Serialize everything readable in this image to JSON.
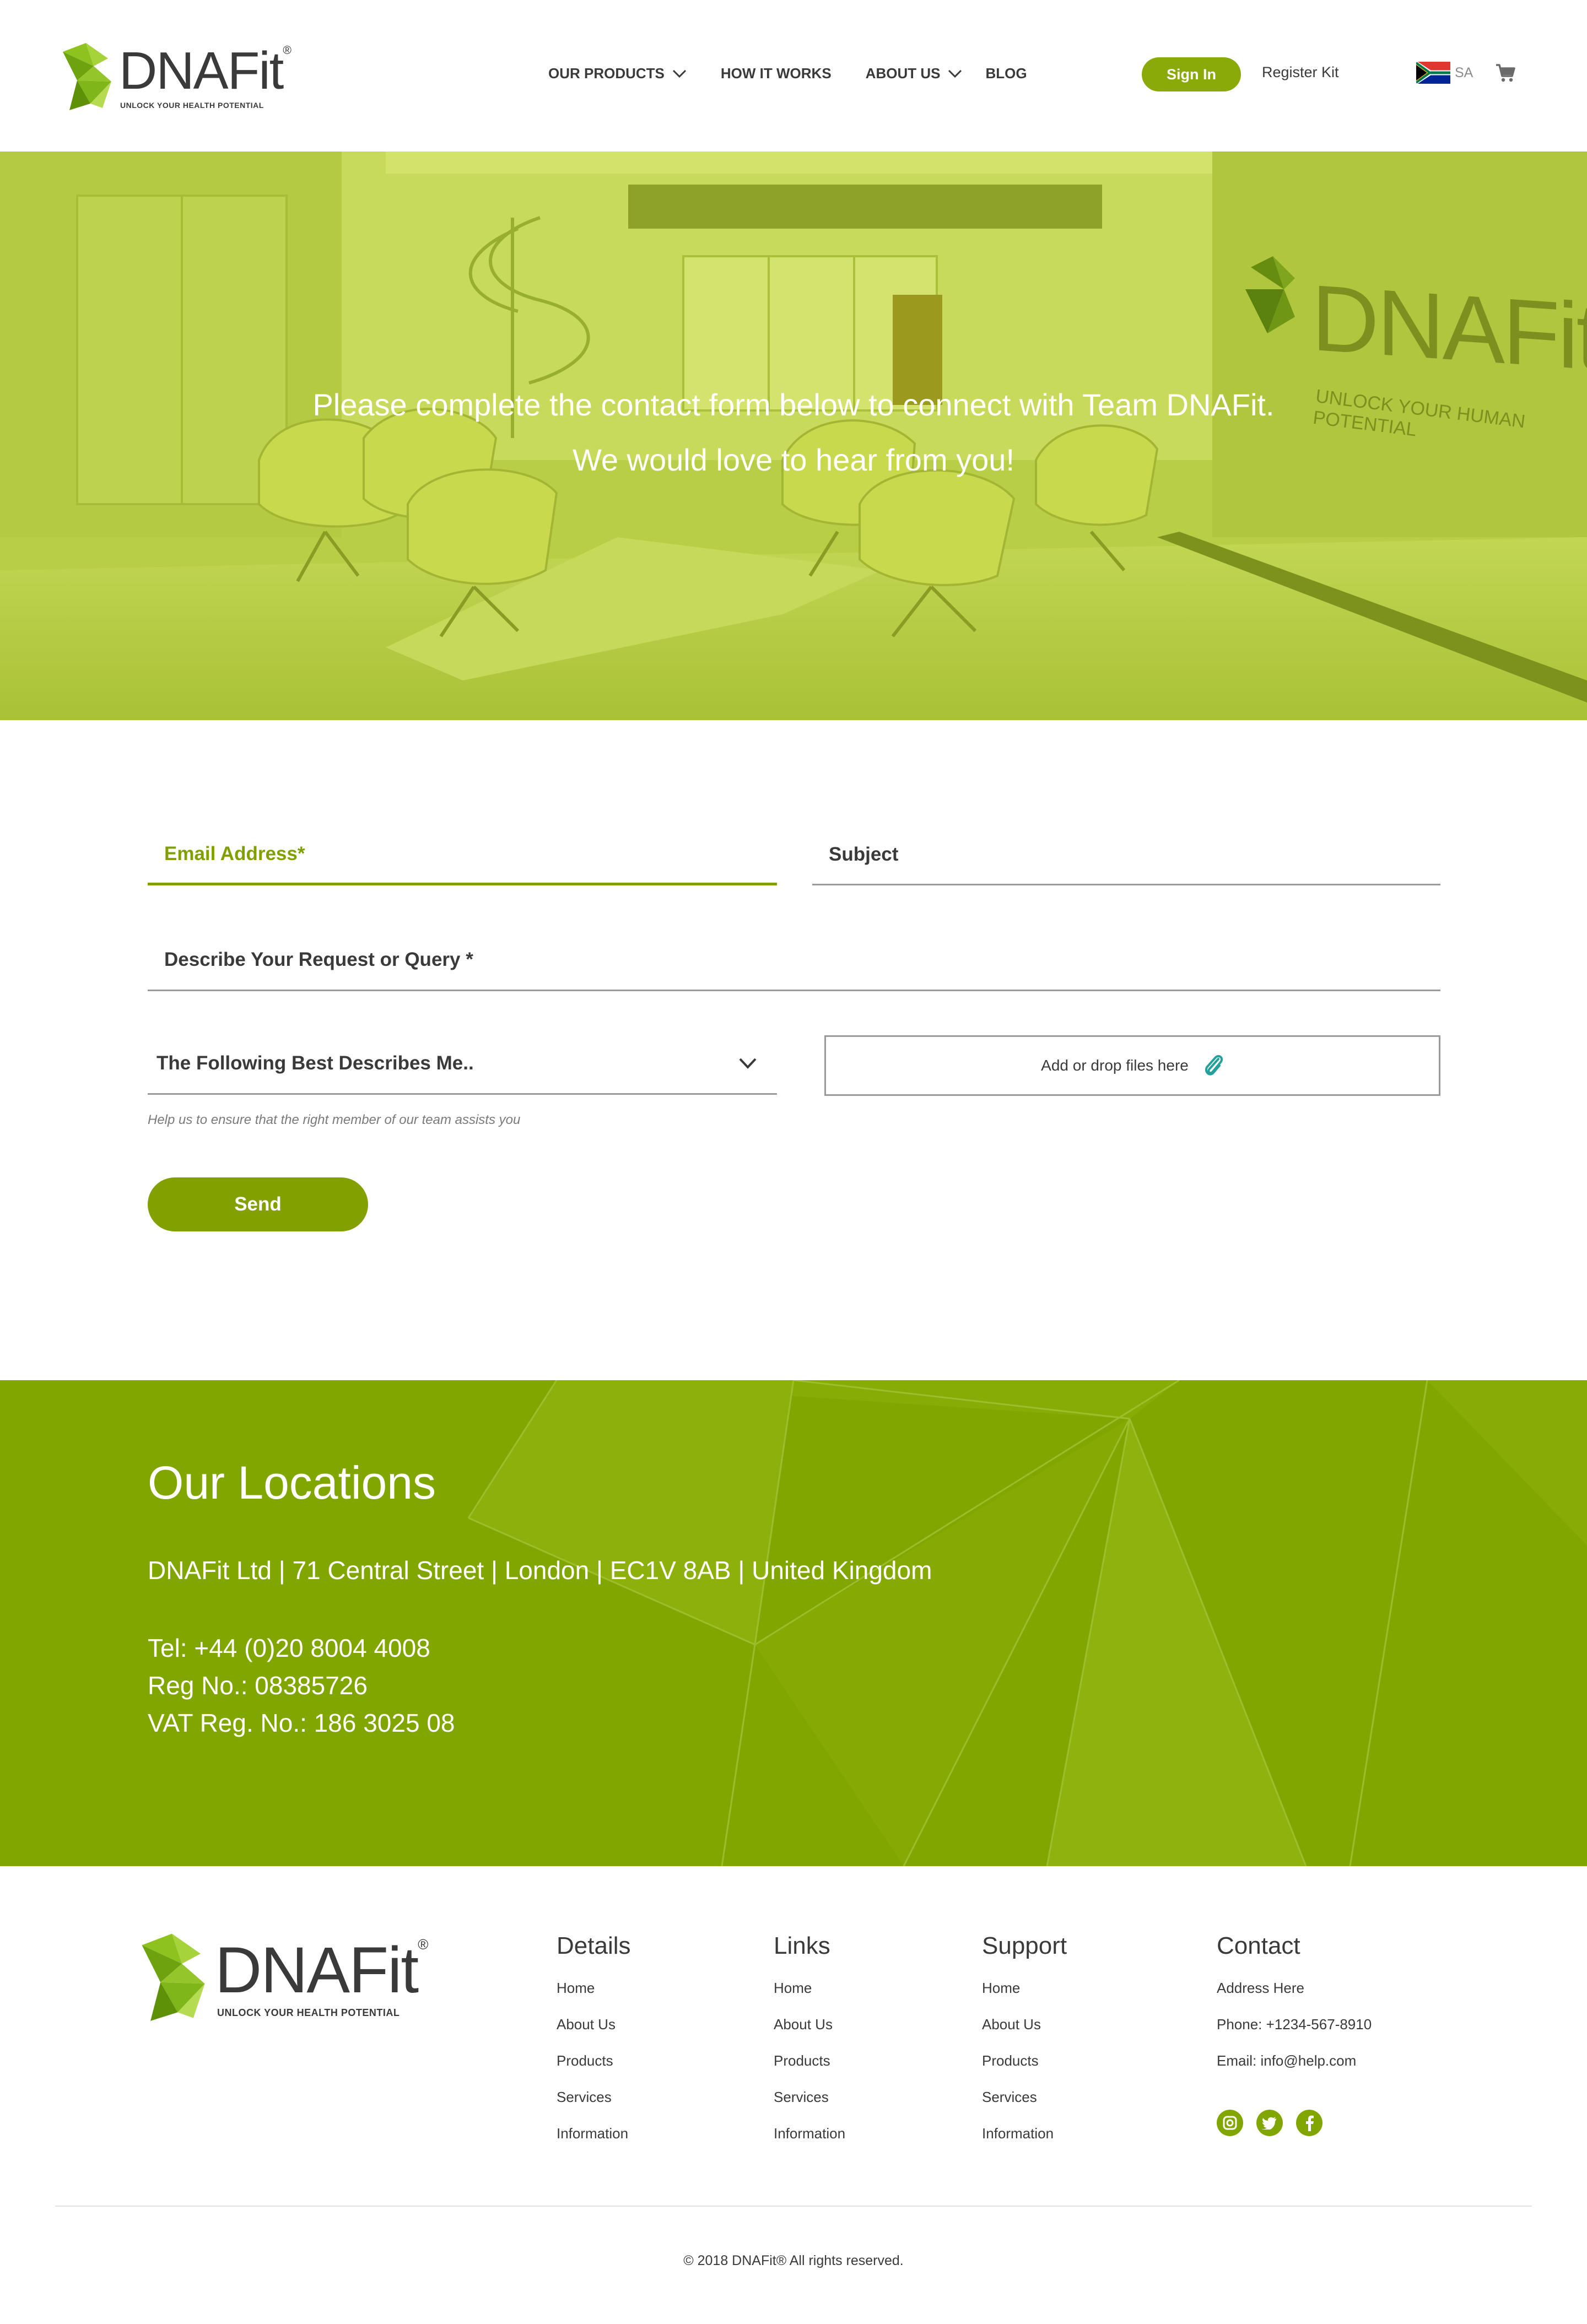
{
  "header": {
    "logo": {
      "brand": "DNAFit",
      "registered": "®",
      "tagline": "UNLOCK YOUR HEALTH POTENTIAL"
    },
    "nav": [
      {
        "label": "OUR PRODUCTS",
        "has_dropdown": true
      },
      {
        "label": "HOW IT WORKS",
        "has_dropdown": false
      },
      {
        "label": "ABOUT US",
        "has_dropdown": true
      },
      {
        "label": "BLOG",
        "has_dropdown": false
      }
    ],
    "sign_in_label": "Sign In",
    "register_label": "Register Kit",
    "region_label": "SA",
    "flag_icon": "south-africa-flag-icon",
    "cart_icon": "cart-icon"
  },
  "hero": {
    "line1": "Please complete the contact form below to connect with Team DNAFit.",
    "line2": "We would love to hear from you!",
    "wall_brand": "DNAFit",
    "wall_tagline": "UNLOCK YOUR HUMAN POTENTIAL"
  },
  "form": {
    "email_placeholder": "Email Address*",
    "subject_placeholder": "Subject",
    "query_placeholder": "Describe Your Request or Query *",
    "describes_select": "The Following Best Describes Me..",
    "describes_hint": "Help us to ensure that the right member of our team assists you",
    "upload_label": "Add or drop files here",
    "send_label": "Send"
  },
  "locations": {
    "title": "Our Locations",
    "address": "DNAFit Ltd | 71 Central Street | London | EC1V 8AB | United Kingdom",
    "tel": "Tel: +44 (0)20 8004 4008",
    "reg": "Reg No.: 08385726",
    "vat": "VAT Reg. No.: 186 3025 08"
  },
  "footer": {
    "logo": {
      "brand": "DNAFit",
      "registered": "®",
      "tagline": "UNLOCK YOUR HEALTH POTENTIAL"
    },
    "details": {
      "title": "Details",
      "items": [
        "Home",
        "About Us",
        "Products",
        "Services",
        "Information"
      ]
    },
    "links": {
      "title": "Links",
      "items": [
        "Home",
        "About Us",
        "Products",
        "Services",
        "Information"
      ]
    },
    "support": {
      "title": "Support",
      "items": [
        "Home",
        "About Us",
        "Products",
        "Services",
        "Information"
      ]
    },
    "contact": {
      "title": "Contact",
      "address": "Address Here",
      "phone": "Phone: +1234-567-8910",
      "email": "Email: info@help.com",
      "social": [
        "instagram-icon",
        "twitter-icon",
        "facebook-icon"
      ]
    },
    "copyright": "© 2018 DNAFit® All rights reserved."
  },
  "colors": {
    "brand_green": "#82a600",
    "accent_green": "#7fa000",
    "hero_tint": "#b2c83e",
    "text_dark": "#3a3a3a"
  }
}
